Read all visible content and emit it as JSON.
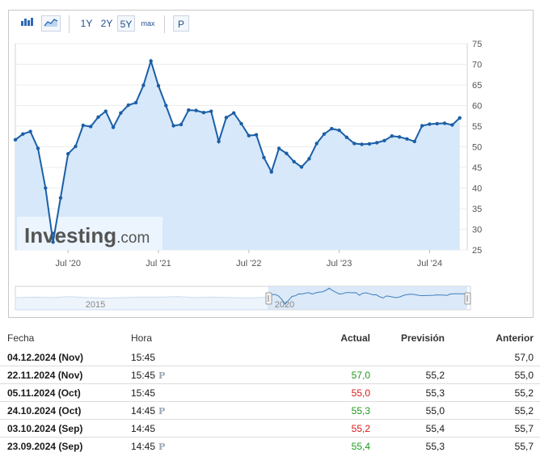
{
  "toolbar": {
    "buttons": [
      "1Y",
      "2Y",
      "5Y",
      "max",
      "P"
    ],
    "active": "5Y"
  },
  "chart_data": {
    "type": "area",
    "x_tick_labels": [
      "Jul '20",
      "Jul '21",
      "Jul '22",
      "Jul '23",
      "Jul '24"
    ],
    "y_ticks": [
      25,
      30,
      35,
      40,
      45,
      50,
      55,
      60,
      65,
      70,
      75
    ],
    "ylim": [
      25,
      75
    ],
    "xlim": [
      "2019-12",
      "2024-12"
    ],
    "y_axis_side": "right",
    "grid": true,
    "line_color": "#1b5fa6",
    "fill_color": "#d6e8fa",
    "series": [
      {
        "x": [
          "2019-12",
          "2020-01",
          "2020-02",
          "2020-03",
          "2020-04",
          "2020-05",
          "2020-06",
          "2020-07",
          "2020-08",
          "2020-09",
          "2020-10",
          "2020-11",
          "2020-12",
          "2021-01",
          "2021-02",
          "2021-03",
          "2021-04",
          "2021-05",
          "2021-06",
          "2021-07",
          "2021-08",
          "2021-09",
          "2021-10",
          "2021-11",
          "2021-12",
          "2022-01",
          "2022-02",
          "2022-03",
          "2022-04",
          "2022-05",
          "2022-06",
          "2022-07",
          "2022-08",
          "2022-09",
          "2022-10",
          "2022-11",
          "2022-12",
          "2023-01",
          "2023-02",
          "2023-03",
          "2023-04",
          "2023-05",
          "2023-06",
          "2023-07",
          "2023-08",
          "2023-09",
          "2023-10",
          "2023-11",
          "2023-12",
          "2024-01",
          "2024-02",
          "2024-03",
          "2024-04",
          "2024-05",
          "2024-06",
          "2024-07",
          "2024-08",
          "2024-09",
          "2024-10",
          "2024-11"
        ],
        "values": [
          51.7,
          53.1,
          53.7,
          49.6,
          40.0,
          26.9,
          37.6,
          48.3,
          50.1,
          55.2,
          54.9,
          57.2,
          58.6,
          54.7,
          58.2,
          60.1,
          60.7,
          64.9,
          70.8,
          64.8,
          60.0,
          55.1,
          55.4,
          58.9,
          58.8,
          58.3,
          58.6,
          51.3,
          57.1,
          58.2,
          55.6,
          52.7,
          52.9,
          47.4,
          43.9,
          49.6,
          48.4,
          46.4,
          45.1,
          47.1,
          50.8,
          53.1,
          54.4,
          54.0,
          52.3,
          50.8,
          50.6,
          50.7,
          51.0,
          51.5,
          52.6,
          52.4,
          51.9,
          51.3,
          55.1,
          55.5,
          55.6,
          55.7,
          55.3,
          57.0
        ]
      }
    ],
    "navigator": {
      "labels": [
        "2015",
        "2020"
      ]
    }
  },
  "table": {
    "headers": [
      "Fecha",
      "Hora",
      "Actual",
      "Previsión",
      "Anterior"
    ],
    "rows": [
      {
        "date": "04.12.2024 (Nov)",
        "time": "15:45",
        "p": false,
        "actual": "",
        "actual_color": "",
        "forecast": "",
        "previous": "57,0"
      },
      {
        "date": "22.11.2024 (Nov)",
        "time": "15:45",
        "p": true,
        "actual": "57,0",
        "actual_color": "green",
        "forecast": "55,2",
        "previous": "55,0"
      },
      {
        "date": "05.11.2024 (Oct)",
        "time": "15:45",
        "p": false,
        "actual": "55,0",
        "actual_color": "red",
        "forecast": "55,3",
        "previous": "55,2"
      },
      {
        "date": "24.10.2024 (Oct)",
        "time": "14:45",
        "p": true,
        "actual": "55,3",
        "actual_color": "green",
        "forecast": "55,0",
        "previous": "55,2"
      },
      {
        "date": "03.10.2024 (Sep)",
        "time": "14:45",
        "p": false,
        "actual": "55,2",
        "actual_color": "red",
        "forecast": "55,4",
        "previous": "55,7"
      },
      {
        "date": "23.09.2024 (Sep)",
        "time": "14:45",
        "p": true,
        "actual": "55,4",
        "actual_color": "green",
        "forecast": "55,3",
        "previous": "55,7"
      }
    ],
    "p_mark": "P"
  },
  "watermark": "Investing.com"
}
